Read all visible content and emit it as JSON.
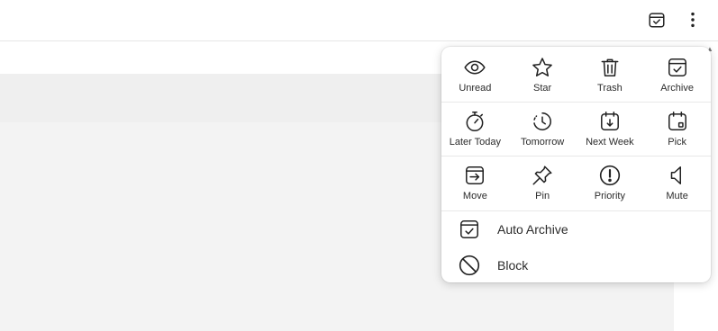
{
  "toolbar": {
    "icons": [
      "calendar-check-icon",
      "more-vertical-icon"
    ]
  },
  "menu": {
    "grid": [
      [
        {
          "label": "Unread",
          "icon": "eye-icon"
        },
        {
          "label": "Star",
          "icon": "star-icon"
        },
        {
          "label": "Trash",
          "icon": "trash-icon"
        },
        {
          "label": "Archive",
          "icon": "archive-check-icon"
        }
      ],
      [
        {
          "label": "Later Today",
          "icon": "stopwatch-icon"
        },
        {
          "label": "Tomorrow",
          "icon": "clock-rotate-icon"
        },
        {
          "label": "Next Week",
          "icon": "calendar-arrow-icon"
        },
        {
          "label": "Pick",
          "icon": "calendar-pick-icon"
        }
      ],
      [
        {
          "label": "Move",
          "icon": "move-box-icon"
        },
        {
          "label": "Pin",
          "icon": "pin-icon"
        },
        {
          "label": "Priority",
          "icon": "priority-exclamation-icon"
        },
        {
          "label": "Mute",
          "icon": "mute-speaker-icon"
        }
      ]
    ],
    "list": [
      {
        "label": "Auto Archive",
        "icon": "auto-archive-icon"
      },
      {
        "label": "Block",
        "icon": "block-icon"
      }
    ]
  }
}
